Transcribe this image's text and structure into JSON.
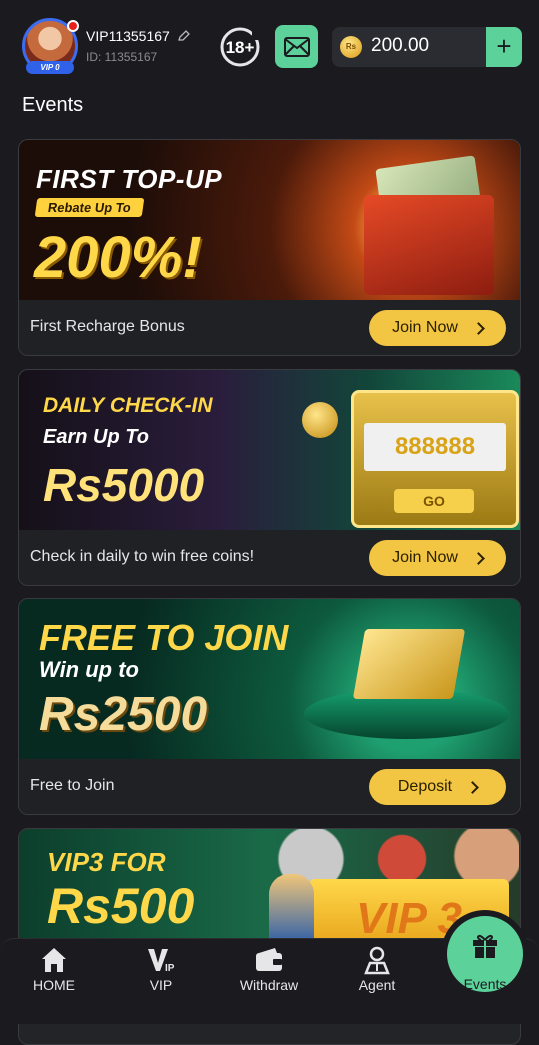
{
  "header": {
    "username": "VIP11355167",
    "user_id": "ID: 11355167",
    "vip_level": "VIP 0",
    "age_restriction": "18+",
    "currency_symbol": "Rs",
    "balance": "200.00",
    "add_label": "+"
  },
  "page_title": "Events",
  "events": [
    {
      "banner_line1": "FIRST TOP-UP",
      "banner_pill": "Rebate Up To",
      "banner_big": "200%!",
      "description": "First Recharge Bonus",
      "button_label": "Join Now"
    },
    {
      "banner_line1": "DAILY CHECK-IN",
      "banner_line2": "Earn Up To",
      "banner_big": "Rs5000",
      "slot_reels": "888888",
      "slot_button": "GO",
      "description": "Check in daily to win free coins!",
      "button_label": "Join Now"
    },
    {
      "banner_line1": "FREE TO JOIN",
      "banner_line2": "Win up to",
      "banner_big": "Rs2500",
      "description": "Free to Join",
      "button_label": "Deposit"
    },
    {
      "banner_line1": "VIP3 FOR",
      "banner_big": "Rs500",
      "vip_badge": "VIP 3"
    }
  ],
  "nav": {
    "home": "HOME",
    "vip": "VIP",
    "withdraw": "Withdraw",
    "agent": "Agent",
    "events": "Events"
  },
  "colors": {
    "accent_green": "#5cd19a",
    "button_yellow": "#f2c542",
    "background": "#1b1b1f",
    "avatar_ring": "#3c6cf0"
  }
}
